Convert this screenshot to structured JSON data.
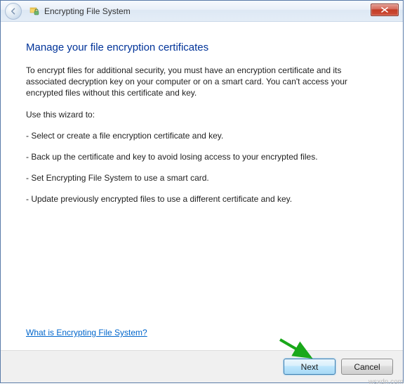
{
  "titlebar": {
    "title": "Encrypting File System"
  },
  "content": {
    "heading": "Manage your file encryption certificates",
    "intro": "To encrypt files for additional security, you must have an encryption certificate and its associated decryption key on your computer or on a smart card. You can't access your encrypted files without this certificate and key.",
    "use_wizard_label": "Use this wizard to:",
    "bullets": {
      "b1": "- Select or create a file encryption certificate and key.",
      "b2": "- Back up the certificate and key to avoid losing access to your encrypted files.",
      "b3": "- Set Encrypting File System to use a smart card.",
      "b4": "- Update previously encrypted files to use a different certificate and key."
    },
    "help_link": "What is Encrypting File System?"
  },
  "buttons": {
    "next": "Next",
    "cancel": "Cancel"
  },
  "watermark": "wsxdn.com"
}
